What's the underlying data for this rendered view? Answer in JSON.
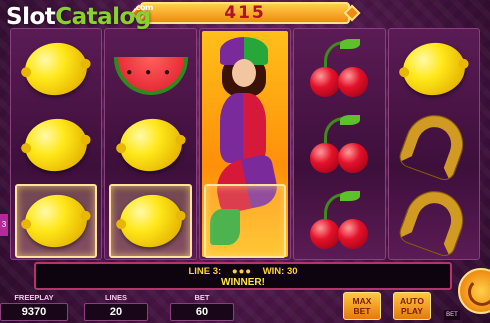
{
  "watermark": {
    "part1": "Slot",
    "part2": "Catalog",
    "suffix": ".com"
  },
  "win_display": {
    "value": "415"
  },
  "reels": [
    [
      "lemon",
      "lemon",
      "lemon"
    ],
    [
      "watermelon",
      "lemon",
      "lemon"
    ],
    [
      "jester-wild"
    ],
    [
      "cherry",
      "cherry",
      "cherry"
    ],
    [
      "lemon",
      "horseshoe",
      "horseshoe"
    ]
  ],
  "side_marker": "3",
  "status": {
    "line_label": "LINE 3:",
    "symbols": "●●●",
    "win_label": "WIN: 30",
    "message": "WINNER!"
  },
  "counters": {
    "freeplay": {
      "label": "FREEPLAY",
      "value": "9370"
    },
    "lines": {
      "label": "LINES",
      "value": "20"
    },
    "bet": {
      "label": "BET",
      "value": "60"
    }
  },
  "buttons": {
    "max_bet": {
      "line1": "MAX",
      "line2": "BET"
    },
    "auto_play": {
      "line1": "AUTO",
      "line2": "PLAY"
    },
    "bet_tag": "BET"
  },
  "colors": {
    "accent": "#f08a12",
    "status_text": "#ffd23a",
    "frame": "#b8336c"
  }
}
